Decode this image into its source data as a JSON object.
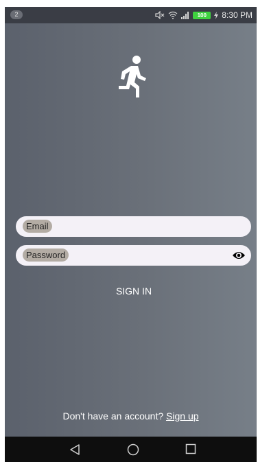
{
  "status_bar": {
    "notification_count": "2",
    "battery_level": "100",
    "time": "8:30 PM",
    "icons": [
      "mute-icon",
      "wifi-icon",
      "signal-icon",
      "battery-icon",
      "charging-icon"
    ]
  },
  "app": {
    "logo_icon": "running-person-icon",
    "email_label": "Email",
    "password_label": "Password",
    "password_toggle_icon": "eye-icon",
    "signin_label": "SIGN IN",
    "signup_prompt": "Don't have an account?",
    "signup_link": "Sign up"
  },
  "nav_bar": {
    "icons": [
      "back-triangle-icon",
      "home-circle-icon",
      "recents-square-icon"
    ]
  },
  "colors": {
    "background_left": "#5b616c",
    "background_right": "#777f88",
    "field_background": "#f4f1f7",
    "label_chip": "#b3aca4",
    "battery": "#3fd23f",
    "text": "#ffffff"
  }
}
